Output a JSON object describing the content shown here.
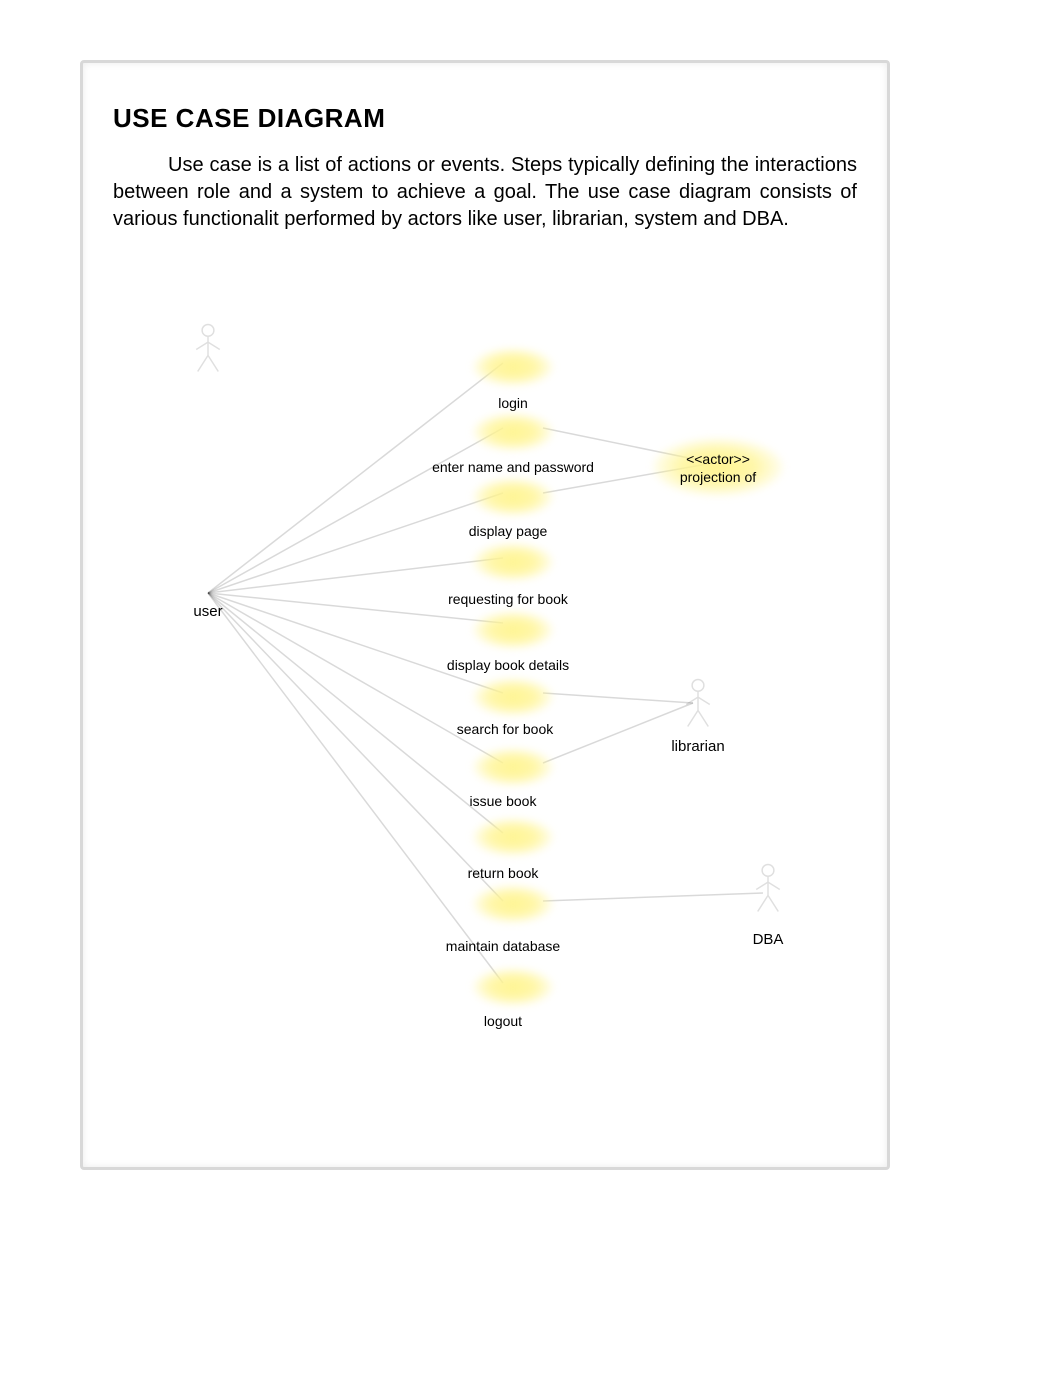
{
  "title": "USE CASE DIAGRAM",
  "intro": "Use case is a list of actions or events. Steps typically defining the interactions between role and a system to achieve a goal. The use case diagram consists of various functionalit performed by actors like user, librarian, system and DBA.",
  "diagram": {
    "actors": {
      "user": "user",
      "librarian": "librarian",
      "dba": "DBA",
      "projection_stereotype": "<<actor>>",
      "projection_of": "projection of"
    },
    "use_cases": [
      "login",
      "enter name and password",
      "display page",
      "requesting for book",
      "display book details",
      "search for book",
      "issue book",
      "return book",
      "maintain database",
      "logout"
    ]
  }
}
